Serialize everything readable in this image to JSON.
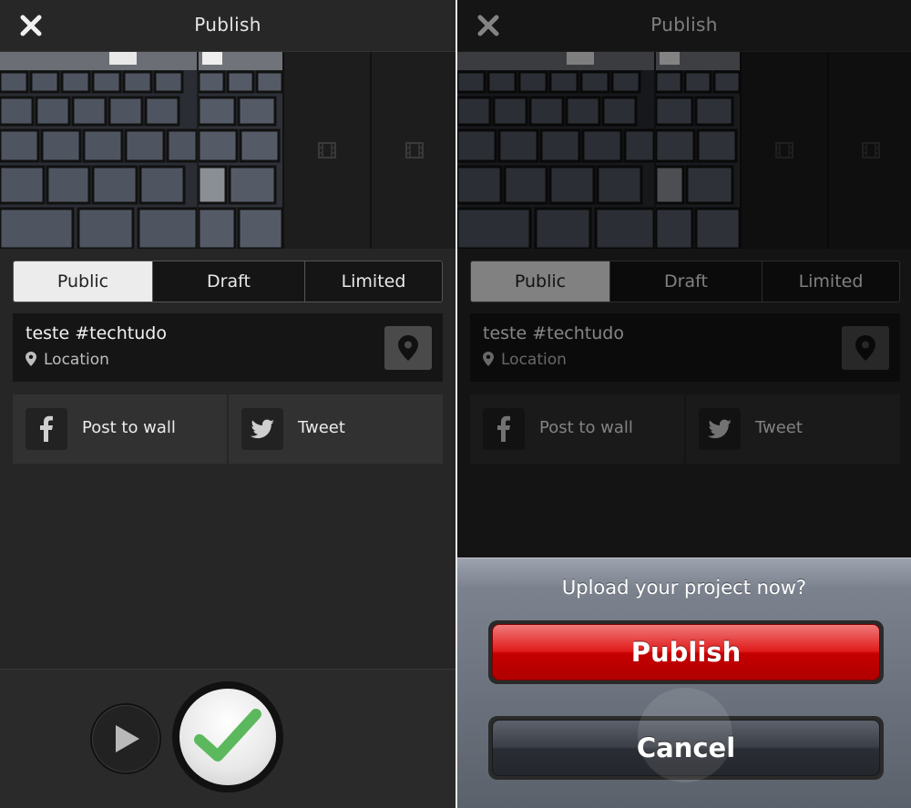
{
  "left": {
    "header": {
      "title": "Publish"
    },
    "visibility_tabs": [
      "Public",
      "Draft",
      "Limited"
    ],
    "selected_visibility": "Public",
    "post": {
      "caption": "teste #techtudo",
      "location_label": "Location"
    },
    "share": {
      "facebook_label": "Post to wall",
      "twitter_label": "Tweet"
    }
  },
  "right": {
    "header": {
      "title": "Publish"
    },
    "visibility_tabs": [
      "Public",
      "Draft",
      "Limited"
    ],
    "post": {
      "caption": "teste #techtudo",
      "location_label": "Location"
    },
    "share": {
      "facebook_label": "Post to wall",
      "twitter_label": "Tweet"
    },
    "dialog": {
      "question": "Upload your project now?",
      "publish_label": "Publish",
      "cancel_label": "Cancel"
    }
  },
  "colors": {
    "publish_red": "#d40000",
    "checkmark_green": "#5cb85c",
    "selected_tab_bg": "#ececec"
  }
}
